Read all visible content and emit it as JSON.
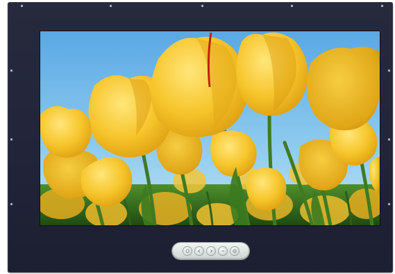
{
  "device": {
    "type": "panel-monitor",
    "bezel_color": "#24273b",
    "screen_image": "yellow-tulips-photo",
    "accent_colors": {
      "sky": "#6fb6e8",
      "tulip": "#f4c12a",
      "stem": "#3f7a22"
    }
  },
  "control_panel": {
    "buttons": [
      {
        "name": "menu-button",
        "icon": "menu-icon"
      },
      {
        "name": "left-button",
        "icon": "left-arrow-icon"
      },
      {
        "name": "right-button",
        "icon": "right-arrow-icon"
      },
      {
        "name": "select-button",
        "icon": "select-icon"
      },
      {
        "name": "power-button",
        "icon": "power-icon"
      }
    ]
  }
}
